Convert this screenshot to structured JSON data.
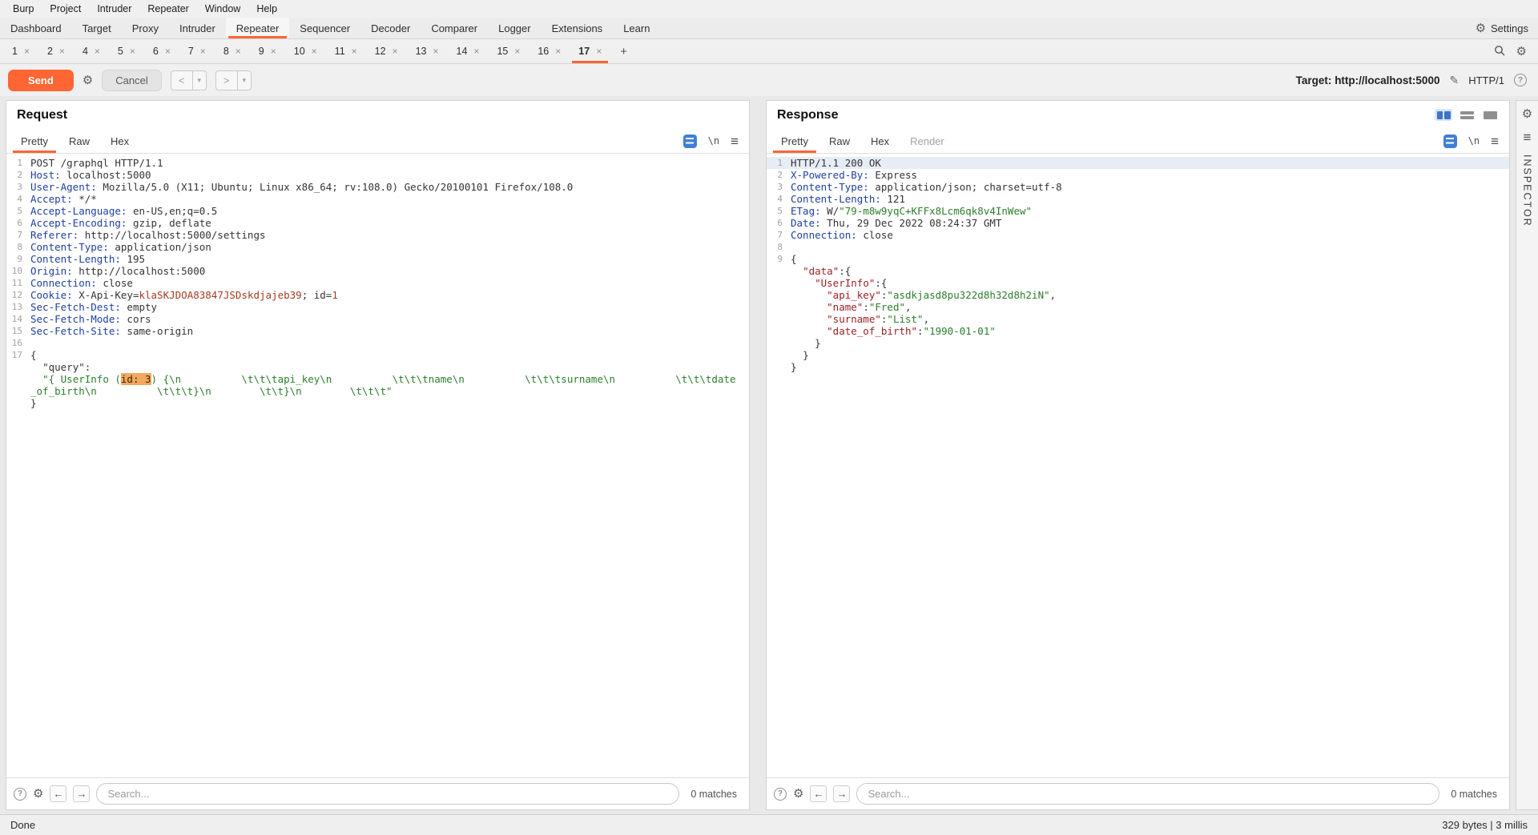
{
  "menu_bar": {
    "items": [
      "Burp",
      "Project",
      "Intruder",
      "Repeater",
      "Window",
      "Help"
    ]
  },
  "main_tabs": {
    "items": [
      "Dashboard",
      "Target",
      "Proxy",
      "Intruder",
      "Repeater",
      "Sequencer",
      "Decoder",
      "Comparer",
      "Logger",
      "Extensions",
      "Learn"
    ],
    "active": "Repeater",
    "settings_label": "Settings"
  },
  "repeater_tabs": {
    "items": [
      "1",
      "2",
      "4",
      "5",
      "6",
      "7",
      "8",
      "9",
      "10",
      "11",
      "12",
      "13",
      "14",
      "15",
      "16",
      "17"
    ],
    "active": "17",
    "close_glyph": "×",
    "add_glyph": "+"
  },
  "toolbar": {
    "send": "Send",
    "cancel": "Cancel",
    "back": "<",
    "forward": ">",
    "caret": "▾",
    "target_label": "Target:",
    "target_value": "http://localhost:5000",
    "protocol": "HTTP/1"
  },
  "request": {
    "title": "Request",
    "tabs": [
      "Pretty",
      "Raw",
      "Hex"
    ],
    "active_tab": "Pretty",
    "newline_glyph": "\\n",
    "search_placeholder": "Search...",
    "matches": "0 matches",
    "lines": [
      {
        "n": "1",
        "seg": [
          {
            "t": "POST /graphql HTTP/1.1",
            "c": "p"
          }
        ]
      },
      {
        "n": "2",
        "seg": [
          {
            "t": "Host:",
            "c": "hn"
          },
          {
            "t": " localhost:5000",
            "c": "hv"
          }
        ]
      },
      {
        "n": "3",
        "seg": [
          {
            "t": "User-Agent:",
            "c": "hn"
          },
          {
            "t": " Mozilla/5.0 (X11; Ubuntu; Linux x86_64; rv:108.0) Gecko/20100101 Firefox/108.0",
            "c": "hv"
          }
        ]
      },
      {
        "n": "4",
        "seg": [
          {
            "t": "Accept:",
            "c": "hn"
          },
          {
            "t": " */*",
            "c": "hv"
          }
        ]
      },
      {
        "n": "5",
        "seg": [
          {
            "t": "Accept-Language:",
            "c": "hn"
          },
          {
            "t": " en-US,en;q=0.5",
            "c": "hv"
          }
        ]
      },
      {
        "n": "6",
        "seg": [
          {
            "t": "Accept-Encoding:",
            "c": "hn"
          },
          {
            "t": " gzip, deflate",
            "c": "hv"
          }
        ]
      },
      {
        "n": "7",
        "seg": [
          {
            "t": "Referer:",
            "c": "hn"
          },
          {
            "t": " http://localhost:5000/settings",
            "c": "hv"
          }
        ]
      },
      {
        "n": "8",
        "seg": [
          {
            "t": "Content-Type:",
            "c": "hn"
          },
          {
            "t": " application/json",
            "c": "hv"
          }
        ]
      },
      {
        "n": "9",
        "seg": [
          {
            "t": "Content-Length:",
            "c": "hn"
          },
          {
            "t": " 195",
            "c": "hv"
          }
        ]
      },
      {
        "n": "10",
        "seg": [
          {
            "t": "Origin:",
            "c": "hn"
          },
          {
            "t": " http://localhost:5000",
            "c": "hv"
          }
        ]
      },
      {
        "n": "11",
        "seg": [
          {
            "t": "Connection:",
            "c": "hn"
          },
          {
            "t": " close",
            "c": "hv"
          }
        ]
      },
      {
        "n": "12",
        "seg": [
          {
            "t": "Cookie:",
            "c": "hn"
          },
          {
            "t": " X-Api-Key=",
            "c": "hv"
          },
          {
            "t": "klaSKJDOA83847JSDskdjajeb39",
            "c": "red"
          },
          {
            "t": "; id=",
            "c": "hv"
          },
          {
            "t": "1",
            "c": "red"
          }
        ]
      },
      {
        "n": "13",
        "seg": [
          {
            "t": "Sec-Fetch-Dest:",
            "c": "hn"
          },
          {
            "t": " empty",
            "c": "hv"
          }
        ]
      },
      {
        "n": "14",
        "seg": [
          {
            "t": "Sec-Fetch-Mode:",
            "c": "hn"
          },
          {
            "t": " cors",
            "c": "hv"
          }
        ]
      },
      {
        "n": "15",
        "seg": [
          {
            "t": "Sec-Fetch-Site:",
            "c": "hn"
          },
          {
            "t": " same-origin",
            "c": "hv"
          }
        ]
      },
      {
        "n": "16",
        "seg": []
      },
      {
        "n": "17",
        "seg": [
          {
            "t": "{",
            "c": "p"
          }
        ]
      },
      {
        "n": "",
        "seg": [
          {
            "t": "  \"query\":",
            "c": "p"
          }
        ]
      },
      {
        "n": "",
        "seg": [
          {
            "t": "  \"{ UserInfo (",
            "c": "str"
          },
          {
            "t": "id: 3",
            "c": "hl"
          },
          {
            "t": ") {\\n          \\t\\t\\tapi_key\\n          \\t\\t\\tname\\n          \\t\\t\\tsurname\\n          \\t\\t\\tdate_of_birth\\n          \\t\\t\\t}\\n        \\t\\t}\\n        \\t\\t\\t\"",
            "c": "str"
          }
        ]
      },
      {
        "n": "",
        "seg": [
          {
            "t": "}",
            "c": "p"
          }
        ]
      }
    ]
  },
  "response": {
    "title": "Response",
    "tabs": [
      "Pretty",
      "Raw",
      "Hex",
      "Render"
    ],
    "active_tab": "Pretty",
    "disabled_tabs": [
      "Render"
    ],
    "newline_glyph": "\\n",
    "search_placeholder": "Search...",
    "matches": "0 matches",
    "lines": [
      {
        "n": "1",
        "sel": true,
        "seg": [
          {
            "t": "HTTP/1.1 200 OK",
            "c": "p"
          }
        ]
      },
      {
        "n": "2",
        "seg": [
          {
            "t": "X-Powered-By:",
            "c": "hn"
          },
          {
            "t": " Express",
            "c": "hv"
          }
        ]
      },
      {
        "n": "3",
        "seg": [
          {
            "t": "Content-Type:",
            "c": "hn"
          },
          {
            "t": " application/json; charset=utf-8",
            "c": "hv"
          }
        ]
      },
      {
        "n": "4",
        "seg": [
          {
            "t": "Content-Length:",
            "c": "hn"
          },
          {
            "t": " 121",
            "c": "hv"
          }
        ]
      },
      {
        "n": "5",
        "seg": [
          {
            "t": "ETag:",
            "c": "hn"
          },
          {
            "t": " W/",
            "c": "hv"
          },
          {
            "t": "\"79-m8w9yqC+KFFx8Lcm6qk8v4InWew\"",
            "c": "str"
          }
        ]
      },
      {
        "n": "6",
        "seg": [
          {
            "t": "Date:",
            "c": "hn"
          },
          {
            "t": " Thu, 29 Dec 2022 08:24:37 GMT",
            "c": "hv"
          }
        ]
      },
      {
        "n": "7",
        "seg": [
          {
            "t": "Connection:",
            "c": "hn"
          },
          {
            "t": " close",
            "c": "hv"
          }
        ]
      },
      {
        "n": "8",
        "seg": []
      },
      {
        "n": "9",
        "seg": [
          {
            "t": "{",
            "c": "p"
          }
        ]
      },
      {
        "n": "",
        "seg": [
          {
            "t": "  ",
            "c": "p"
          },
          {
            "t": "\"data\"",
            "c": "key"
          },
          {
            "t": ":{",
            "c": "p"
          }
        ]
      },
      {
        "n": "",
        "seg": [
          {
            "t": "    ",
            "c": "p"
          },
          {
            "t": "\"UserInfo\"",
            "c": "key"
          },
          {
            "t": ":{",
            "c": "p"
          }
        ]
      },
      {
        "n": "",
        "seg": [
          {
            "t": "      ",
            "c": "p"
          },
          {
            "t": "\"api_key\"",
            "c": "key"
          },
          {
            "t": ":",
            "c": "p"
          },
          {
            "t": "\"asdkjasd8pu322d8h32d8h2iN\"",
            "c": "str"
          },
          {
            "t": ",",
            "c": "p"
          }
        ]
      },
      {
        "n": "",
        "seg": [
          {
            "t": "      ",
            "c": "p"
          },
          {
            "t": "\"name\"",
            "c": "key"
          },
          {
            "t": ":",
            "c": "p"
          },
          {
            "t": "\"Fred\"",
            "c": "str"
          },
          {
            "t": ",",
            "c": "p"
          }
        ]
      },
      {
        "n": "",
        "seg": [
          {
            "t": "      ",
            "c": "p"
          },
          {
            "t": "\"surname\"",
            "c": "key"
          },
          {
            "t": ":",
            "c": "p"
          },
          {
            "t": "\"List\"",
            "c": "str"
          },
          {
            "t": ",",
            "c": "p"
          }
        ]
      },
      {
        "n": "",
        "seg": [
          {
            "t": "      ",
            "c": "p"
          },
          {
            "t": "\"date_of_birth\"",
            "c": "key"
          },
          {
            "t": ":",
            "c": "p"
          },
          {
            "t": "\"1990-01-01\"",
            "c": "str"
          }
        ]
      },
      {
        "n": "",
        "seg": [
          {
            "t": "    }",
            "c": "p"
          }
        ]
      },
      {
        "n": "",
        "seg": [
          {
            "t": "  }",
            "c": "p"
          }
        ]
      },
      {
        "n": "",
        "seg": [
          {
            "t": "}",
            "c": "p"
          }
        ]
      }
    ]
  },
  "inspector": {
    "label": "INSPECTOR"
  },
  "status_bar": {
    "left": "Done",
    "right": "329 bytes | 3 millis"
  }
}
